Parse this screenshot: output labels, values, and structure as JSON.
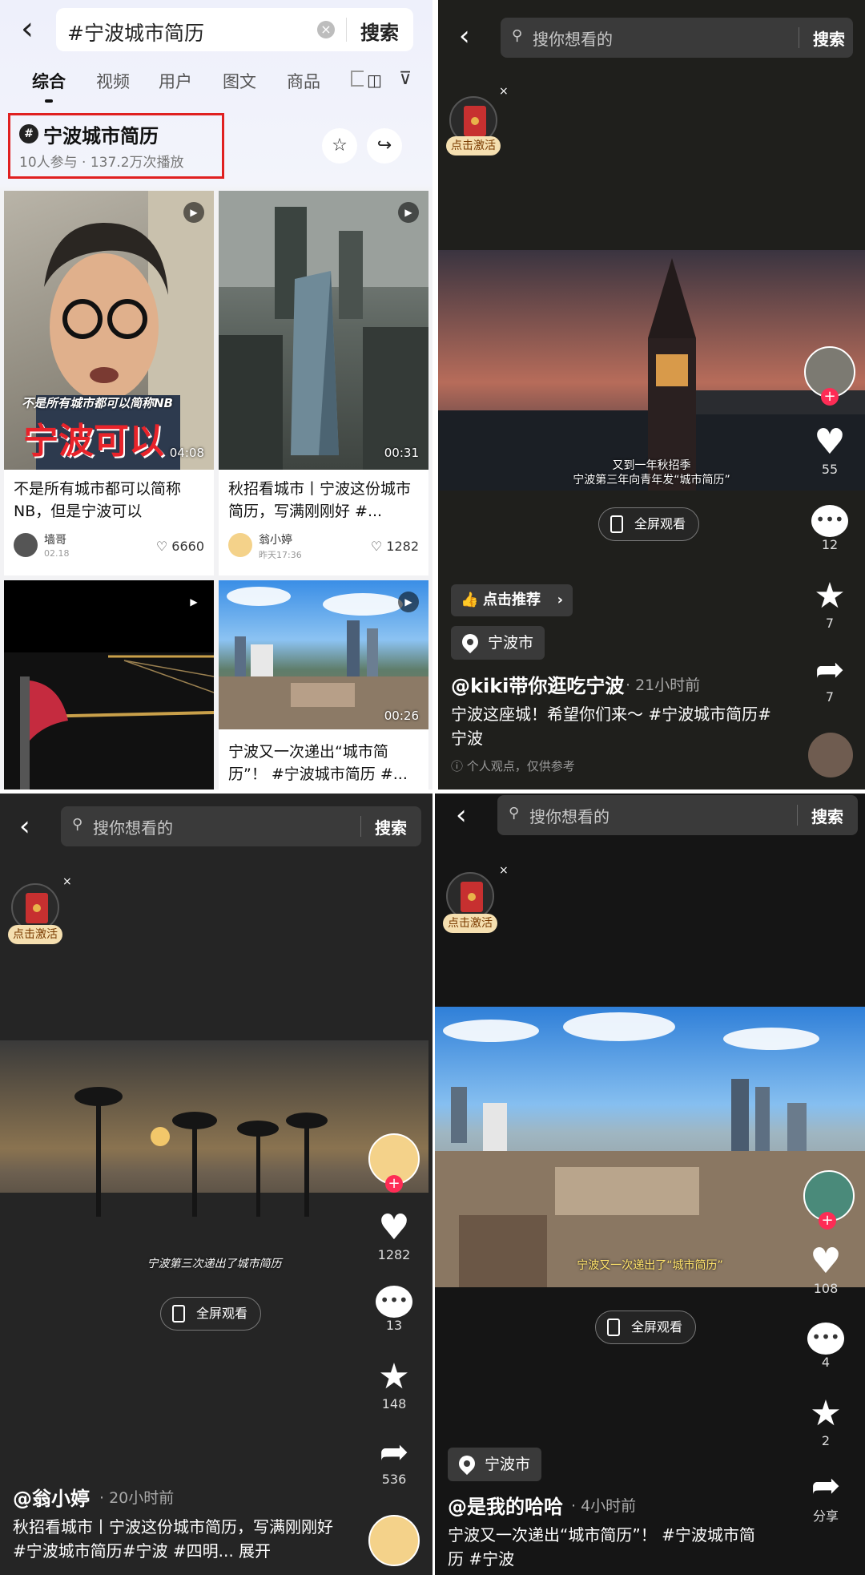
{
  "panel1": {
    "search_query": "#宁波城市简历",
    "search_button": "搜索",
    "tabs": [
      "综合",
      "视频",
      "用户",
      "图文",
      "商品"
    ],
    "topic": {
      "title": "宁波城市简历",
      "stats": "10人参与 · 137.2万次播放"
    },
    "cards": [
      {
        "overlay_line1": "不是所有城市都可以简称NB",
        "overlay_line2": "宁波可以",
        "duration": "04:08",
        "title": "不是所有城市都可以简称NB，但是宁波可以",
        "author": "墙哥",
        "date": "02.18",
        "likes": "6660"
      },
      {
        "duration": "00:31",
        "title": "秋招看城市丨宁波这份城市简历，写满刚刚好 #...",
        "author": "翁小婷",
        "date": "昨天17:36",
        "likes": "1282"
      },
      {
        "title": ""
      },
      {
        "duration": "00:26",
        "title": "宁波又一次递出“城市简历”！ #宁波城市简历 #..."
      }
    ]
  },
  "panel2": {
    "search_placeholder": "搜你想看的",
    "search_button": "搜索",
    "activate": "点击激活",
    "close": "×",
    "subtitle_line1": "又到一年秋招季",
    "subtitle_line2": "宁波第三年向青年发“城市简历”",
    "fullscreen": "全屏观看",
    "recommend": "点击推荐",
    "location": "宁波市",
    "username": "@kiki带你逛吃宁波",
    "time": "· 21小时前",
    "description": "宁波这座城！希望你们来～ #宁波城市简历#宁波",
    "disclaimer": "个人观点，仅供参考",
    "likes": "55",
    "comments": "12",
    "favorites": "7",
    "shares": "7"
  },
  "panel3": {
    "search_placeholder": "搜你想看的",
    "search_button": "搜索",
    "activate": "点击激活",
    "close": "×",
    "subtitle": "宁波第三次递出了城市简历",
    "fullscreen": "全屏观看",
    "username": "@翁小婷",
    "time": "· 20小时前",
    "description": "秋招看城市丨宁波这份城市简历，写满刚刚好 #宁波城市简历#宁波 #四明... 展开",
    "likes": "1282",
    "comments": "13",
    "favorites": "148",
    "shares": "536"
  },
  "panel4": {
    "search_placeholder": "搜你想看的",
    "search_button": "搜索",
    "activate": "点击激活",
    "close": "×",
    "subtitle": "宁波又一次递出了“城市简历”",
    "fullscreen": "全屏观看",
    "location": "宁波市",
    "username": "@是我的哈哈",
    "time": "· 4小时前",
    "description": "宁波又一次递出“城市简历”！ #宁波城市简历 #宁波",
    "likes": "108",
    "comments": "4",
    "favorites": "2",
    "share_label": "分享"
  }
}
